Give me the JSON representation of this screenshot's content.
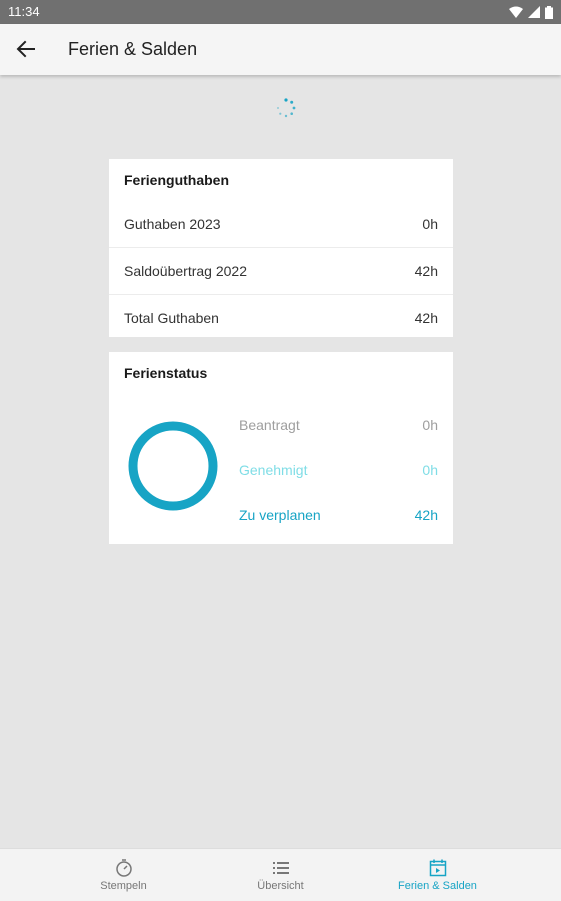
{
  "status_bar": {
    "time": "11:34"
  },
  "app_bar": {
    "title": "Ferien & Salden",
    "back_icon": "arrow-left-icon"
  },
  "ferienguthaben": {
    "title": "Ferienguthaben",
    "rows": [
      {
        "label": "Guthaben 2023",
        "value": "0h"
      },
      {
        "label": "Saldoübertrag 2022",
        "value": "42h"
      },
      {
        "label": "Total Guthaben",
        "value": "42h"
      }
    ]
  },
  "ferienstatus": {
    "title": "Ferienstatus",
    "items": [
      {
        "label": "Beantragt",
        "value": "0h",
        "color": "#9e9e9e"
      },
      {
        "label": "Genehmigt",
        "value": "0h",
        "color": "#7fdde6"
      },
      {
        "label": "Zu verplanen",
        "value": "42h",
        "color": "#17a4c5"
      }
    ]
  },
  "bottom_nav": {
    "items": [
      {
        "label": "Stempeln",
        "icon": "stopwatch-icon",
        "active": false
      },
      {
        "label": "Übersicht",
        "icon": "list-icon",
        "active": false
      },
      {
        "label": "Ferien & Salden",
        "icon": "calendar-icon",
        "active": true
      }
    ]
  },
  "colors": {
    "accent": "#17a4c5",
    "inactive": "#777777",
    "background": "#e5e5e5"
  }
}
